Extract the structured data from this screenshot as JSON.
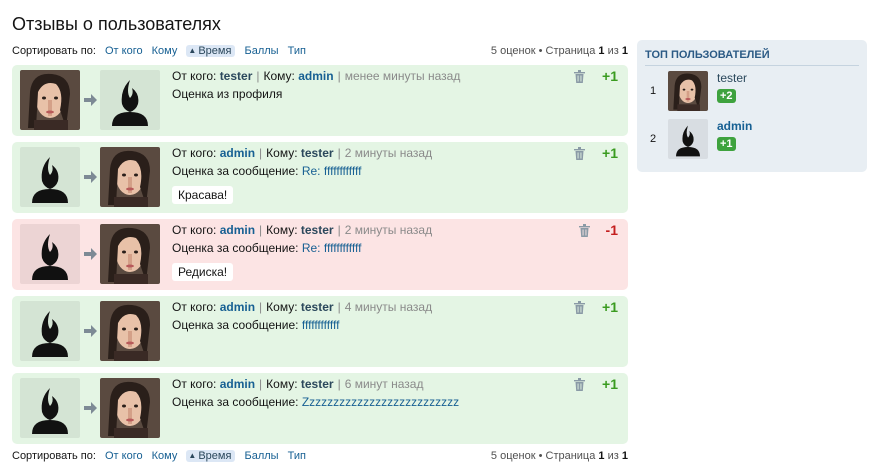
{
  "page": {
    "title": "Отзывы о пользователях"
  },
  "sort": {
    "label": "Сортировать по:",
    "options": [
      "От кого",
      "Кому",
      "Время",
      "Баллы",
      "Тип"
    ],
    "active": "Время",
    "summary_count": "5 оценок",
    "bullet": "•",
    "page_word": "Страница",
    "page_current": "1",
    "page_of": "из",
    "page_total": "1"
  },
  "labels": {
    "from": "От кого:",
    "to": "Кому:"
  },
  "ratings": [
    {
      "from": "tester",
      "to": "admin",
      "time": "менее минуты назад",
      "context": "Оценка из профиля",
      "context_link": "",
      "comment": "",
      "score": "+1",
      "type": "positive"
    },
    {
      "from": "admin",
      "to": "tester",
      "time": "2 минуты назад",
      "context": "Оценка за сообщение: ",
      "context_link": "Re: ffffffffffff",
      "comment": "Красава!",
      "score": "+1",
      "type": "positive"
    },
    {
      "from": "admin",
      "to": "tester",
      "time": "2 минуты назад",
      "context": "Оценка за сообщение: ",
      "context_link": "Re: ffffffffffff",
      "comment": "Редиска!",
      "score": "-1",
      "type": "negative"
    },
    {
      "from": "admin",
      "to": "tester",
      "time": "4 минуты назад",
      "context": "Оценка за сообщение: ",
      "context_link": "ffffffffffff",
      "comment": "",
      "score": "+1",
      "type": "positive"
    },
    {
      "from": "admin",
      "to": "tester",
      "time": "6 минут назад",
      "context": "Оценка за сообщение: ",
      "context_link": "Zzzzzzzzzzzzzzzzzzzzzzzzzz",
      "comment": "",
      "score": "+1",
      "type": "positive"
    }
  ],
  "sidebar": {
    "title": "ТОП ПОЛЬЗОВАТЕЛЕЙ",
    "users": [
      {
        "rank": "1",
        "name": "tester",
        "score": "+2",
        "avatar": "photo"
      },
      {
        "rank": "2",
        "name": "admin",
        "score": "+1",
        "avatar": "default"
      }
    ]
  },
  "icons": {
    "trash": "trash-icon",
    "arrow": "arrow-right-icon",
    "sort_up": "sort-ascending-icon"
  },
  "colors": {
    "positive_bg": "#e4f5e4",
    "negative_bg": "#fce4e4",
    "positive_score": "#3a9b20",
    "negative_score": "#c41e1e",
    "link": "#176093",
    "sidebar_bg": "#e8eef3"
  }
}
